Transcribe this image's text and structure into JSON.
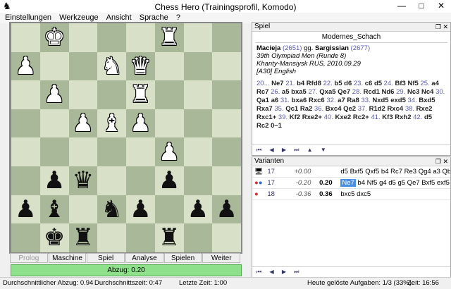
{
  "window": {
    "title": "Chess Hero (Trainingsprofil, Komodo)",
    "minimize": "—",
    "maximize": "□",
    "close": "✕"
  },
  "menu": [
    "Einstellungen",
    "Werkzeuge",
    "Ansicht",
    "Sprache",
    "?"
  ],
  "board": {
    "rows": [
      [
        "",
        "wk",
        "",
        "",
        "",
        "wr",
        "",
        ""
      ],
      [
        "wp",
        "",
        "",
        "wn",
        "wq",
        "",
        "",
        ""
      ],
      [
        "",
        "wp",
        "",
        "",
        "wr",
        "",
        "",
        ""
      ],
      [
        "",
        "",
        "wp",
        "wb",
        "wp",
        "",
        "",
        ""
      ],
      [
        "",
        "",
        "",
        "",
        "",
        "wp",
        "",
        ""
      ],
      [
        "",
        "bp",
        "bq",
        "",
        "",
        "bp",
        "",
        ""
      ],
      [
        "bp",
        "bb",
        "",
        "bn",
        "bp",
        "",
        "bp",
        "bp"
      ],
      [
        "",
        "bk",
        "br",
        "",
        "",
        "br",
        "",
        ""
      ]
    ]
  },
  "buttons": [
    "Prolog",
    "Maschine",
    "Spiel",
    "Analyse",
    "Spielen",
    "Weiter"
  ],
  "eval": "Abzug: 0.20",
  "spiel": {
    "panel_title": "Spiel",
    "opening": "Modernes_Schach",
    "white": "Macieja",
    "white_elo": "(2651)",
    "vs": "gg.",
    "black": "Sargissian",
    "black_elo": "(2677)",
    "event": "39th Olympiad Men (Runde 8)",
    "place": "Khanty-Mansiysk RUS, 2010.09.29",
    "eco": "[A30] English",
    "moves": [
      [
        "20...",
        "Ne7"
      ],
      [
        "21.",
        "b4 Rfd8"
      ],
      [
        "22.",
        "b5 d6"
      ],
      [
        "23.",
        "c6 d5"
      ],
      [
        "24.",
        "Bf3 Nf5"
      ],
      [
        "25.",
        "a4 Rc7"
      ],
      [
        "26.",
        "a5 bxa5"
      ],
      [
        "27.",
        "Qxa5 Qe7"
      ],
      [
        "28.",
        "Rcd1 Nd6"
      ],
      [
        "29.",
        "Nc3 Nc4"
      ],
      [
        "30.",
        "Qa1 a6"
      ],
      [
        "31.",
        "bxa6 Rxc6"
      ],
      [
        "32.",
        "a7 Ra8"
      ],
      [
        "33.",
        "Nxd5 exd5"
      ],
      [
        "34.",
        "Bxd5 Rxa7"
      ],
      [
        "35.",
        "Qc1"
      ],
      [
        "",
        "Ra2"
      ],
      [
        "36.",
        "Bxc4 Qe2"
      ],
      [
        "37.",
        "R1d2 Rxc4"
      ],
      [
        "38.",
        "Rxe2 Rxc1+"
      ],
      [
        "39.",
        "Kf2 Rxe2+"
      ],
      [
        "40.",
        "Kxe2 Rc2+"
      ],
      [
        "41.",
        "Kf3 Rxh2"
      ],
      [
        "42.",
        "d5 Rc2"
      ],
      [
        "",
        "0–1"
      ]
    ]
  },
  "nav_icons": [
    "⏮",
    "◀",
    "▶",
    "⏭",
    "▲",
    "▼"
  ],
  "varianten": {
    "panel_title": "Varianten",
    "rows": [
      {
        "icon": "engine",
        "depth": "17",
        "score": "+0.00",
        "best": "",
        "line": "d5 Bxf5 Qxf5 b4 Rc7 Re3 Qg4 a3 Qb"
      },
      {
        "icon": "user-red-blue",
        "depth": "17",
        "score": "-0.20",
        "best": "0.20",
        "hl": "Ne7",
        "line": " b4 Nf5 g4 d5 g5 Qe7 Bxf5 exf5"
      },
      {
        "icon": "user-red",
        "depth": "18",
        "score": "-0.36",
        "best": "0.36",
        "line": "bxc5 dxc5"
      }
    ]
  },
  "status": {
    "avg_loss": "Durchschnittlicher Abzug: 0.94",
    "avg_time": "Durchschnittszeit: 0:47",
    "last_time": "Letzte Zeit: 1:00",
    "solved": "Heute gelöste Aufgaben: 1/3 (33%)",
    "time": "Zeit: 16:56"
  }
}
